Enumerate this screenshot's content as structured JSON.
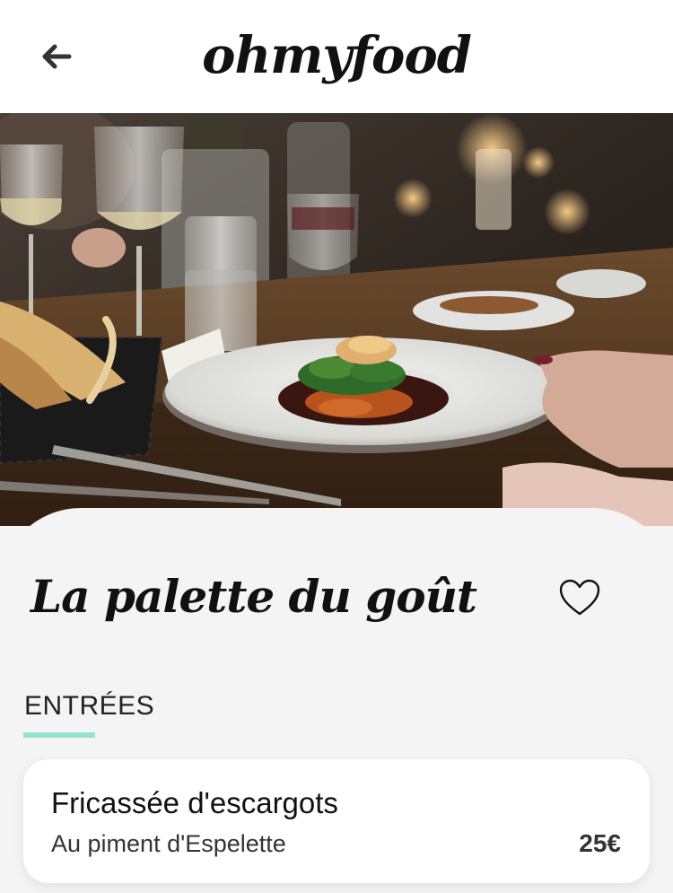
{
  "header": {
    "logo": "ohmyfood",
    "back_icon": "arrow-left-icon"
  },
  "hero": {
    "image": "restaurant-table-plated-dish-photo"
  },
  "restaurant": {
    "name": "La palette du goût",
    "favorite_icon": "heart-outline-icon",
    "favorited": false
  },
  "menu": {
    "section_label": "ENTRÉES",
    "accent_color": "#99e2d0",
    "dishes": [
      {
        "name": "Fricassée d'escargots",
        "description": "Au piment d'Espelette",
        "price": "25€"
      }
    ]
  }
}
